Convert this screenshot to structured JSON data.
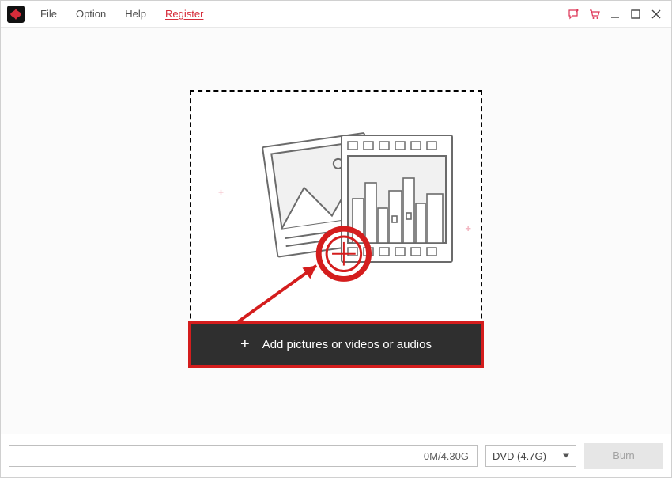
{
  "menubar": {
    "file": "File",
    "option": "Option",
    "help": "Help",
    "register": "Register"
  },
  "main": {
    "add_label": "Add pictures or videos or audios"
  },
  "status": {
    "capacity": "0M/4.30G",
    "disc_sel": "DVD (4.7G)",
    "burn": "Burn"
  },
  "accent": "#d41d1d",
  "deco_plus": "+"
}
